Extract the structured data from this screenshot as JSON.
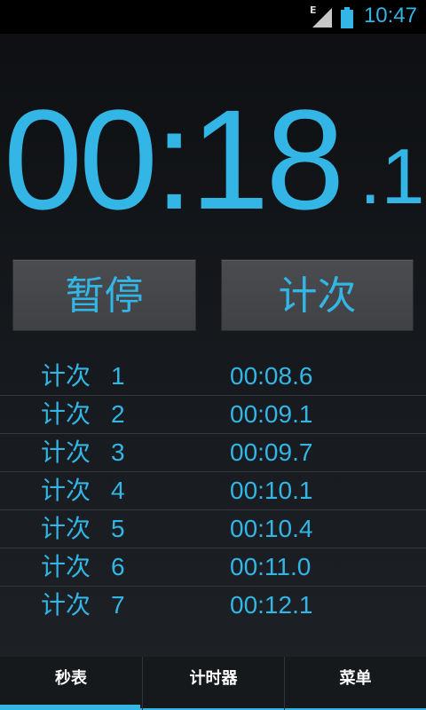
{
  "status_bar": {
    "time": "10:47",
    "network_type": "E",
    "icons": [
      "signal-icon",
      "battery-icon"
    ]
  },
  "stopwatch": {
    "main": "00:18",
    "tenths": ".1"
  },
  "buttons": {
    "pause_label": "暂停",
    "lap_label": "计次"
  },
  "laps": [
    {
      "label": "计次",
      "number": "1",
      "time": "00:08.6"
    },
    {
      "label": "计次",
      "number": "2",
      "time": "00:09.1"
    },
    {
      "label": "计次",
      "number": "3",
      "time": "00:09.7"
    },
    {
      "label": "计次",
      "number": "4",
      "time": "00:10.1"
    },
    {
      "label": "计次",
      "number": "5",
      "time": "00:10.4"
    },
    {
      "label": "计次",
      "number": "6",
      "time": "00:11.0"
    },
    {
      "label": "计次",
      "number": "7",
      "time": "00:12.1"
    }
  ],
  "tabs": [
    {
      "label": "秒表",
      "selected": true
    },
    {
      "label": "计时器",
      "selected": false
    },
    {
      "label": "菜单",
      "selected": false
    }
  ],
  "colors": {
    "accent": "#33b5e5",
    "background": "#15181c",
    "button": "#424447"
  }
}
